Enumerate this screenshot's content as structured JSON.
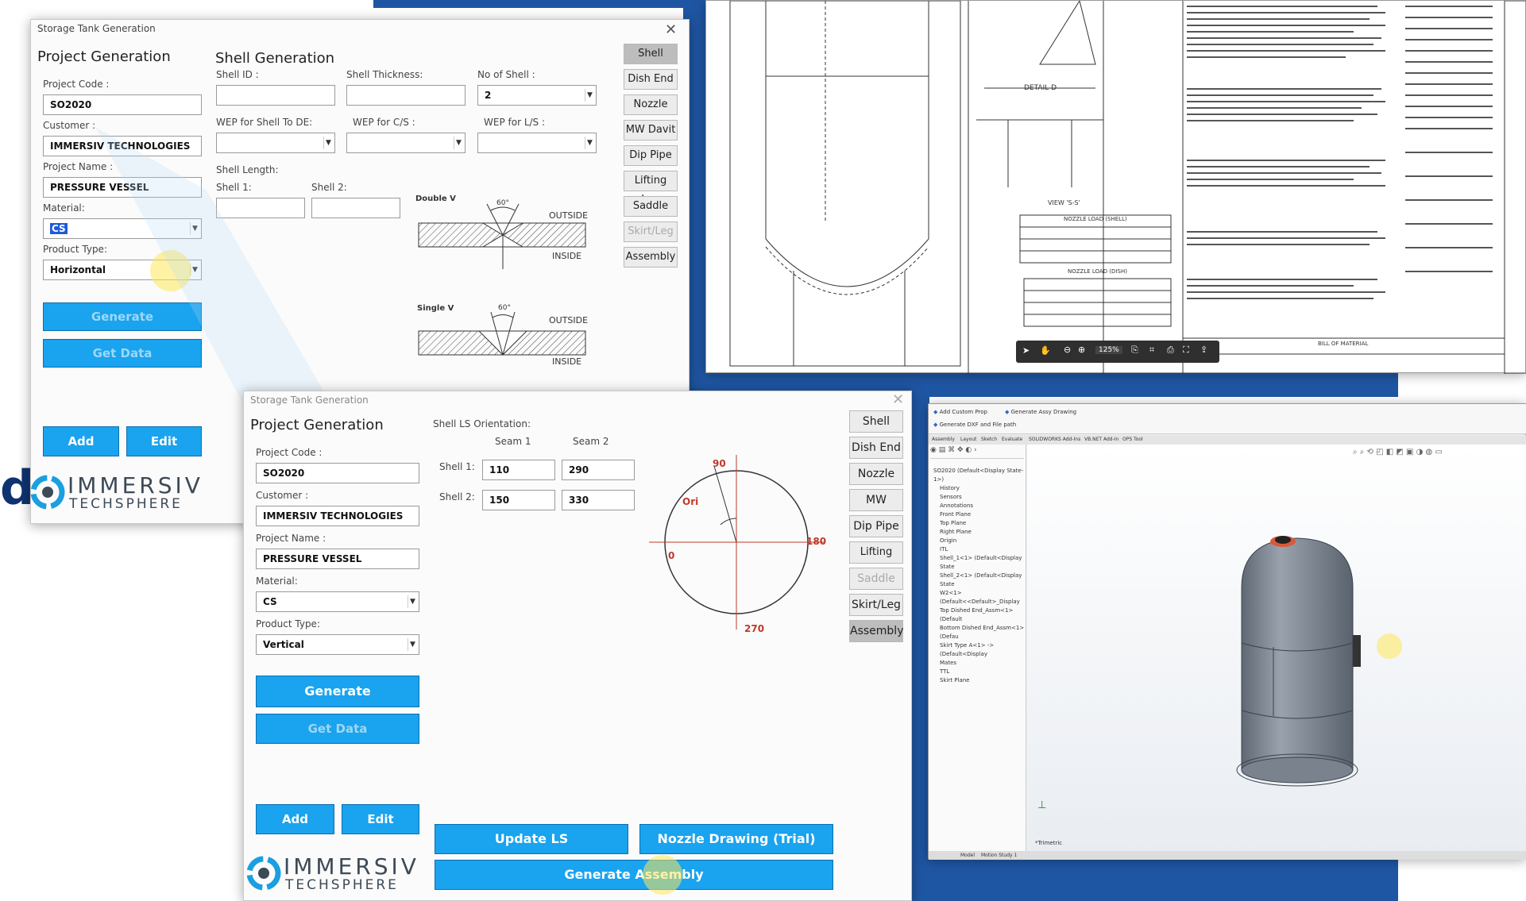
{
  "window1": {
    "title": "Storage Tank Generation",
    "close": "✕",
    "project": {
      "heading": "Project Generation",
      "code_label": "Project Code :",
      "code_value": "SO2020",
      "customer_label": "Customer :",
      "customer_value": "IMMERSIV TECHNOLOGIES",
      "name_label": "Project Name :",
      "name_value": "PRESSURE VESSEL",
      "material_label": "Material:",
      "material_value": "CS",
      "type_label": "Product Type:",
      "type_value": "Horizontal",
      "generate_label": "Generate",
      "getdata_label": "Get Data",
      "add_label": "Add",
      "edit_label": "Edit"
    },
    "shell": {
      "heading": "Shell Generation",
      "id_label": "Shell ID :",
      "thickness_label": "Shell Thickness:",
      "no_label": "No of Shell :",
      "no_value": "2",
      "wep_de_label": "WEP for Shell To DE:",
      "wep_cs_label": "WEP for C/S :",
      "wep_ls_label": "WEP for L/S :",
      "length_label": "Shell Length:",
      "shell1_label": "Shell 1:",
      "shell2_label": "Shell 2:",
      "double_v": "Double V",
      "single_v": "Single V",
      "outside": "OUTSIDE",
      "inside": "INSIDE",
      "angle": "60°"
    },
    "side_buttons": [
      "Shell",
      "Dish End",
      "Nozzle",
      "MW Davit",
      "Dip Pipe",
      "Lifting Lug",
      "Saddle",
      "Skirt/Leg",
      "Assembly"
    ]
  },
  "window2": {
    "title": "Storage Tank Generation",
    "close": "✕",
    "project": {
      "heading": "Project Generation",
      "code_label": "Project Code :",
      "code_value": "SO2020",
      "customer_label": "Customer :",
      "customer_value": "IMMERSIV TECHNOLOGIES",
      "name_label": "Project Name :",
      "name_value": "PRESSURE VESSEL",
      "material_label": "Material:",
      "material_value": "CS",
      "type_label": "Product Type:",
      "type_value": "Vertical",
      "generate_label": "Generate",
      "getdata_label": "Get Data",
      "add_label": "Add",
      "edit_label": "Edit"
    },
    "ls": {
      "heading": "Shell LS Orientation:",
      "seam1": "Seam 1",
      "seam2": "Seam 2",
      "shell1_label": "Shell 1:",
      "shell2_label": "Shell 2:",
      "s1_seam1": "110",
      "s1_seam2": "290",
      "s2_seam1": "150",
      "s2_seam2": "330",
      "deg_90": "90",
      "deg_180": "180",
      "deg_270": "270",
      "deg_0": "0",
      "ori": "Ori"
    },
    "update_ls": "Update LS",
    "nozzle_drawing": "Nozzle Drawing (Trial)",
    "generate_assembly": "Generate Assembly",
    "side_buttons": [
      "Shell",
      "Dish End",
      "Nozzle",
      "MW Davit",
      "Dip Pipe",
      "Lifting Lug",
      "Saddle",
      "Skirt/Leg",
      "Assembly"
    ]
  },
  "logo": {
    "line1": "IMMERSIV",
    "line2": "TECHSPHERE"
  },
  "drawing": {
    "detail_label": "DETAIL D",
    "view_label": "VIEW 'S-S'",
    "nozzle_load_shell": "NOZZLE LOAD (SHELL)",
    "nozzle_load_dish": "NOZZLE LOAD (DISH)",
    "bill_of_material": "BILL OF MATERIAL",
    "zoom": "125%"
  },
  "cad": {
    "tool1": "Add Custom Prop",
    "tool2": "Generate Assy Drawing",
    "tool3": "Generate DXF and File path",
    "tabs": [
      "Assembly",
      "Layout",
      "Sketch",
      "Evaluate",
      "SOLIDWORKS Add-Ins",
      "VB.NET Add-In",
      "OPS Tool"
    ],
    "tree": [
      "SO2020 (Default<Display State-1>)",
      "History",
      "Sensors",
      "Annotations",
      "Front Plane",
      "Top Plane",
      "Right Plane",
      "Origin",
      "ITL",
      "Shell_1<1> (Default<Display State",
      "Shell_2<1> (Default<Display State",
      "W2<1> (Default<<Default>_Display",
      "Top Dished End_Assm<1> (Default",
      "Bottom Dished End_Assm<1> (Defau",
      "Skirt Type A<1> -> (Default<Display",
      "Mates",
      "TTL",
      "Skirt Plane"
    ],
    "view_label": "*Trimetric",
    "bottom_tabs": [
      "Model",
      "Motion Study 1"
    ]
  },
  "colors": {
    "accent_blue": "#1aa3ee",
    "bg_blue": "#1f56a3",
    "tank": "#7d8794"
  }
}
